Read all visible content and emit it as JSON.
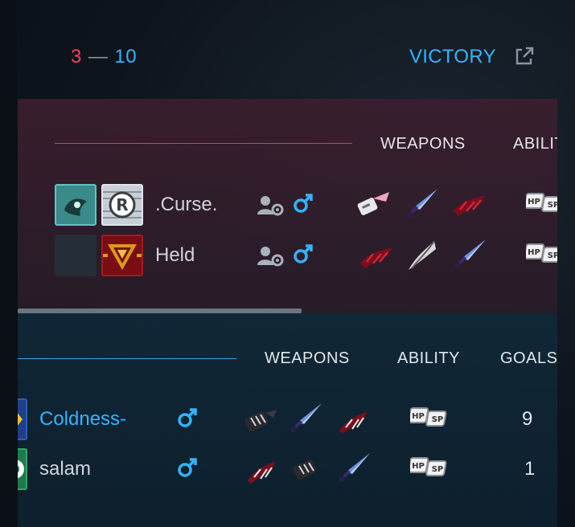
{
  "header": {
    "score_red": "3",
    "score_sep": "—",
    "score_blue": "10",
    "result": "VICTORY"
  },
  "colors": {
    "red_team": "#ff3b5c",
    "blue_team": "#32b4ff",
    "panel_red": "#3c1e2e",
    "panel_blue": "#102838"
  },
  "red_team": {
    "columns": [
      "WEAPONS",
      "ABILITY"
    ],
    "players": [
      {
        "name": ".Curse.",
        "gender": "male"
      },
      {
        "name": "Held",
        "gender": "male"
      }
    ]
  },
  "blue_team": {
    "columns": [
      "WEAPONS",
      "ABILITY",
      "GOALS"
    ],
    "players": [
      {
        "name": "Coldness-",
        "gender": "male",
        "goals": "9"
      },
      {
        "name": "salam",
        "gender": "male",
        "goals": "1"
      }
    ]
  },
  "ability_badge": {
    "hp": "HP",
    "sp": "SP"
  }
}
